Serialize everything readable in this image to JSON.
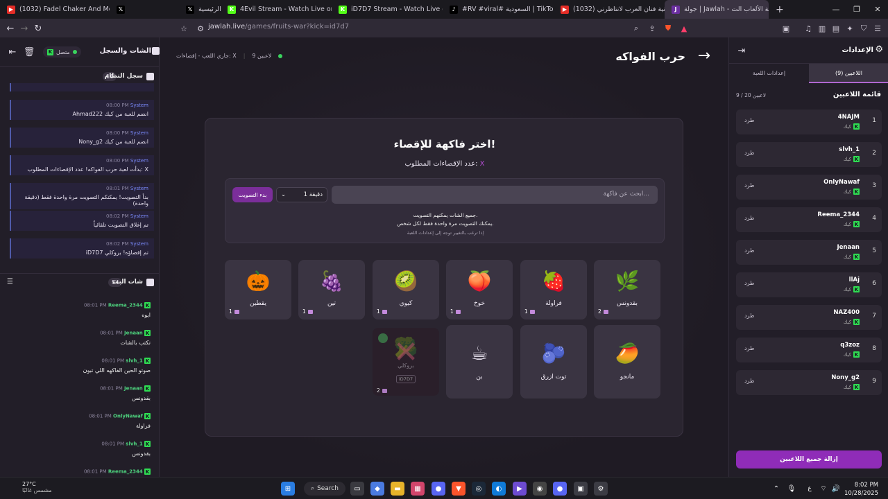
{
  "browser": {
    "tabs": [
      {
        "label": "(1032) Fadel Chaker And Mohamed ...",
        "icon": "youtube-icon",
        "color": "#e52d27"
      },
      {
        "label": "",
        "icon": "x-icon",
        "color": "#000000"
      },
      {
        "label": "الرئيسية / X",
        "icon": "x-icon",
        "color": "#000000"
      },
      {
        "label": "4Evil Stream - Watch Live on Kick",
        "icon": "kick-icon",
        "color": "#53fc18"
      },
      {
        "label": "iD7D7 Stream - Watch Live on Kick",
        "icon": "kick-icon",
        "color": "#53fc18"
      },
      {
        "label": "#RV #viral# السعودية | TikTok",
        "icon": "tiktok-icon",
        "color": "#000000"
      },
      {
        "label": "(1032) اغنية فنان العرب لانتاظرني",
        "icon": "youtube-icon",
        "color": "#e52d27"
      },
      {
        "label": "جولة | Jawlah - منصة الألعاب الت...",
        "icon": "jawlah-icon",
        "color": "#6b2fa0"
      }
    ],
    "url_host": "jawlah.live",
    "url_path": "/games/fruits-war?kick=id7d7"
  },
  "left": {
    "title": "الشات والسجل",
    "status": "متصل",
    "system_log_title": "سجل النظام",
    "system_log_count": "16",
    "system_messages": [
      {
        "user": "System",
        "time": "08:00 PM",
        "text": "Ahmad222 انضم للعبة من كيك"
      },
      {
        "user": "System",
        "time": "08:00 PM",
        "text": "Nony_g2 انضم للعبة من كيك"
      },
      {
        "user": "System",
        "time": "08:00 PM",
        "text": "بدأت لعبة حرب الفواكه! عدد الإقصاءات المطلوب: X"
      },
      {
        "user": "System",
        "time": "08:01 PM",
        "text": "بدأ التصويت! يمكنكم التصويت مرة واحدة فقط (دقيقة واحدة)"
      },
      {
        "user": "System",
        "time": "08:02 PM",
        "text": "تم إغلاق التصويت تلقائياً"
      },
      {
        "user": "System",
        "time": "08:02 PM",
        "text": "iD7D7 تم إقصاؤه! بروكلي"
      }
    ],
    "live_chat_title": "شات البث",
    "live_chat_count": "54",
    "chat_messages": [
      {
        "user": "Reema_2344",
        "time": "08:01 PM",
        "text": "ايوه"
      },
      {
        "user": "Jenaan",
        "time": "08:01 PM",
        "text": "تكتب بالشات"
      },
      {
        "user": "slvh_1",
        "time": "08:01 PM",
        "text": "صوتو الحين الفاكهه اللي تبون"
      },
      {
        "user": "Jenaan",
        "time": "08:01 PM",
        "text": "بقدونس"
      },
      {
        "user": "OnlyNawaf",
        "time": "08:01 PM",
        "text": "فراولة"
      },
      {
        "user": "slvh_1",
        "time": "08:01 PM",
        "text": "بقدونس"
      },
      {
        "user": "Reema_2344",
        "time": "08:01 PM",
        "text": ""
      }
    ]
  },
  "center": {
    "title": "حرب الفواكه",
    "players_count": "9 لاعبين",
    "game_state": "جاري اللعب - إقصاءات: X",
    "heading": "اختر فاكهة للإقصاء!",
    "subheading": "عدد الإقصاءات المطلوب:",
    "subheading_value": "X",
    "search_placeholder": "ابحث عن فاكهة...",
    "duration": "1 دقيقة",
    "start_vote": "بدء التصويت",
    "note1": "جميع الشات يمكنهم التصويت.",
    "note2": "يمكنك التصويت مرة واحدة فقط لكل شخص.",
    "note3": "إذا ترغب بالتغيير توجه إلى إعدادات اللعبة",
    "fruits": [
      {
        "name": "بقدونس",
        "emoji": "🌿",
        "votes": "2"
      },
      {
        "name": "فراولة",
        "emoji": "🍓",
        "votes": "1"
      },
      {
        "name": "خوخ",
        "emoji": "🍑",
        "votes": "1"
      },
      {
        "name": "كيوي",
        "emoji": "🥝",
        "votes": "1"
      },
      {
        "name": "تين",
        "emoji": "🍇",
        "votes": "1"
      },
      {
        "name": "يقطين",
        "emoji": "🎃",
        "votes": "1"
      },
      {
        "name": "مانجو",
        "emoji": "🥭",
        "votes": ""
      },
      {
        "name": "توت ازرق",
        "emoji": "🫐",
        "votes": ""
      },
      {
        "name": "بن",
        "emoji": "☕",
        "votes": ""
      }
    ],
    "eliminated": {
      "name": "بروكلي",
      "emoji": "🥦",
      "owner": "iD7D7",
      "votes": "2"
    }
  },
  "right": {
    "title": "الإعدادات",
    "tab_players": "اللاعبين (9)",
    "tab_settings": "إعدادات اللعبة",
    "list_title": "قائمة اللاعبين",
    "list_count": "9 / 20 لاعبين",
    "platform": "كيك",
    "kick_label": "طرد",
    "players": [
      "4NAJM",
      "slvh_1",
      "OnlyNawaf",
      "Reema_2344",
      "Jenaan",
      "llAj",
      "NAZ400",
      "q3zoz",
      "Nony_g2"
    ],
    "remove_all": "إزالة جميع اللاعبين"
  },
  "taskbar": {
    "temp": "27°C",
    "weather": "مشمس غالبًا",
    "search": "Search",
    "time": "8:02 PM",
    "date": "10/28/2025"
  }
}
